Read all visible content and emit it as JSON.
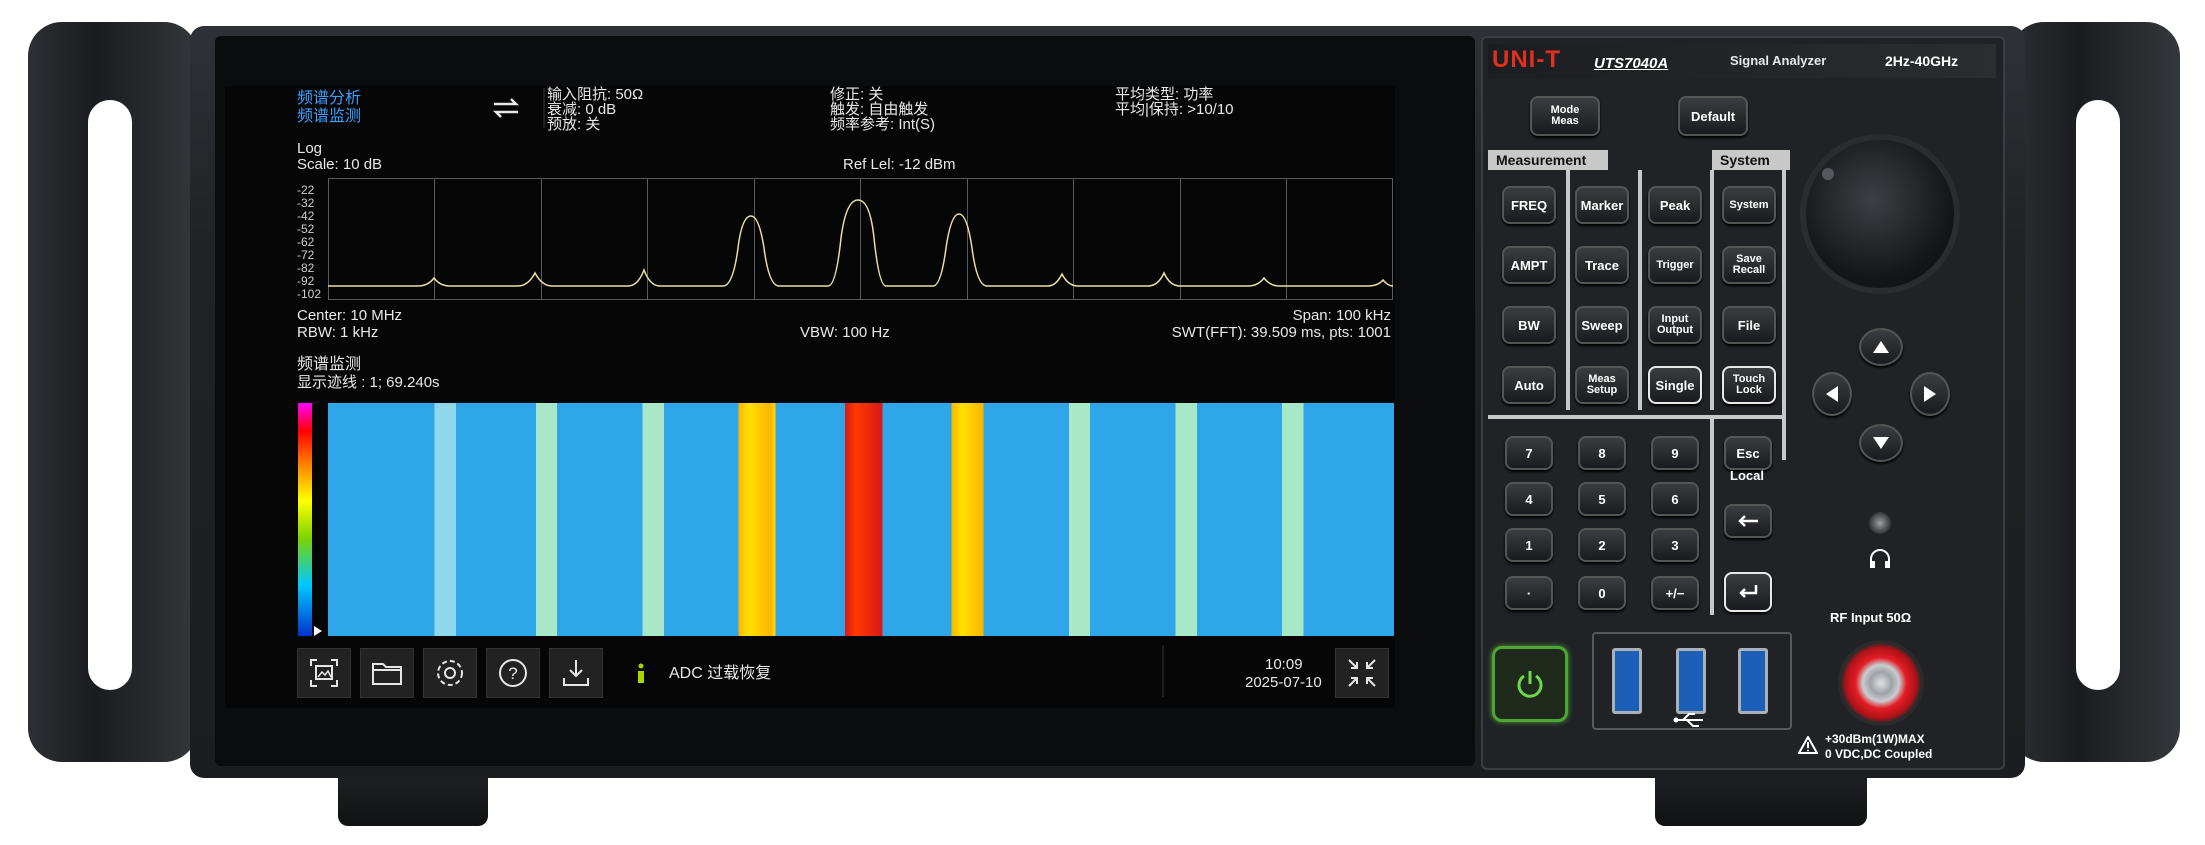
{
  "screen": {
    "mode_line1": "频谱分析",
    "mode_line2": "频谱监测",
    "params": {
      "input_impedance": "输入阻抗: 50Ω",
      "attenuation": "衰减: 0 dB",
      "preamp": "预放: 关",
      "correction": "修正: 关",
      "trigger": "触发: 自由触发",
      "freq_ref": "频率参考: Int(S)",
      "avg_type": "平均类型: 功率",
      "avg_hold": "平均|保持: >10/10"
    },
    "spectrum": {
      "scale_mode": "Log",
      "scale": "Scale: 10 dB",
      "ref_level": "Ref Lel: -12 dBm",
      "y_ticks": [
        "-22",
        "-32",
        "-42",
        "-52",
        "-62",
        "-72",
        "-82",
        "-92",
        "-102"
      ],
      "center": "Center: 10 MHz",
      "span": "Span: 100 kHz",
      "rbw": "RBW: 1 kHz",
      "vbw": "VBW: 100 Hz",
      "swt": "SWT(FFT): 39.509 ms, pts: 1001"
    },
    "waterfall": {
      "title": "频谱监测",
      "trace_info": "显示迹线 : 1; 69.240s"
    },
    "status": {
      "message": "ADC 过载恢复",
      "time": "10:09",
      "date": "2025-07-10"
    },
    "colors": {
      "accent": "#3aa0ff",
      "trace": "#e8dfa0",
      "status_icon": "#a6d600"
    },
    "toolbar_icons": [
      "screenshot-icon",
      "folder-icon",
      "gear-icon",
      "help-icon",
      "download-icon"
    ]
  },
  "panel": {
    "brand": "UNI-T",
    "model": "UTS7040A",
    "product": "Signal Analyzer",
    "freq_range": "2Hz-40GHz",
    "mode_meas_1": "Mode",
    "mode_meas_2": "Meas",
    "default": "Default",
    "measurement": "Measurement",
    "system_head": "System",
    "keys": {
      "freq": "FREQ",
      "marker": "Marker",
      "peak": "Peak",
      "system": "System",
      "ampt": "AMPT",
      "trace": "Trace",
      "trigger": "Trigger",
      "save1": "Save",
      "save2": "Recall",
      "bw": "BW",
      "sweep": "Sweep",
      "io1": "Input",
      "io2": "Output",
      "file": "File",
      "auto": "Auto",
      "ms1": "Meas",
      "ms2": "Setup",
      "single": "Single",
      "tl1": "Touch",
      "tl2": "Lock",
      "k7": "7",
      "k8": "8",
      "k9": "9",
      "k4": "4",
      "k5": "5",
      "k6": "6",
      "k1": "1",
      "k2": "2",
      "k3": "3",
      "kdot": "·",
      "k0": "0",
      "kpm": "+/−",
      "esc": "Esc",
      "local": "Local"
    },
    "rf_input": "RF Input  50Ω",
    "warning1": "+30dBm(1W)MAX",
    "warning2": "0 VDC,DC Coupled"
  }
}
